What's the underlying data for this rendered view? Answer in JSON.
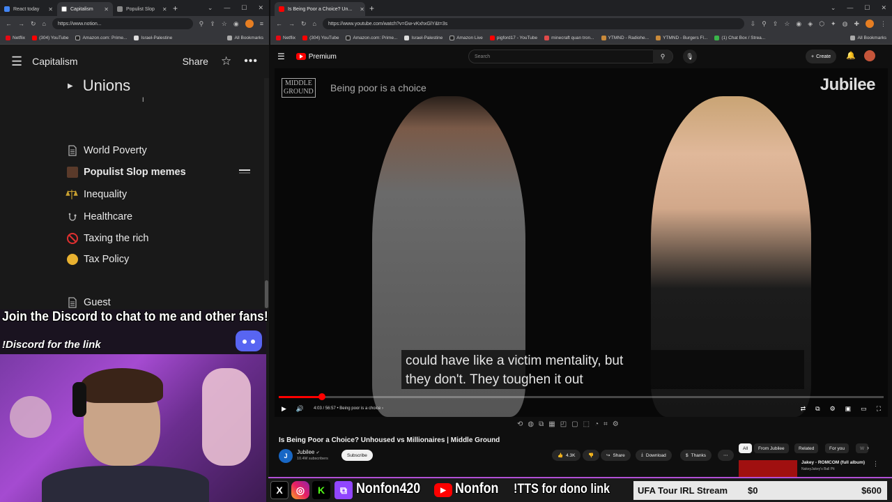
{
  "left_browser": {
    "tabs": [
      {
        "title": "React today",
        "active": false,
        "color": "#4285f4"
      },
      {
        "title": "Capitalism",
        "active": true,
        "color": "#ffffff"
      },
      {
        "title": "Populist Slop",
        "active": false,
        "color": "#8a8a8a"
      }
    ],
    "url": "https://www.notion...",
    "bookmarks": [
      "Netflix",
      "(304) YouTube",
      "Amazon.com: Prime...",
      "Israel-Palestine"
    ],
    "all_bookmarks": "All Bookmarks"
  },
  "notion": {
    "page_title": "Capitalism",
    "share_label": "Share",
    "heading": "Unions",
    "items": [
      {
        "label": "World Poverty",
        "icon": "document-icon"
      },
      {
        "label": "Populist Slop memes",
        "icon": "image-icon"
      },
      {
        "label": "Inequality",
        "icon": "scales-icon"
      },
      {
        "label": "Healthcare",
        "icon": "stethoscope-icon"
      },
      {
        "label": "Taxing the rich",
        "icon": "no-entry-icon"
      },
      {
        "label": "Tax Policy",
        "icon": "coin-icon"
      },
      {
        "label": "Guest",
        "icon": "document-icon"
      }
    ]
  },
  "stream_overlay": {
    "discord_line": "Join the Discord to chat to me and other fans!",
    "discord_sub": "!Discord for the link",
    "handle_1": "Nonfon420",
    "handle_2": "Nonfon",
    "tts": "!TTS for dono link",
    "goal_title": "UFA Tour IRL Stream",
    "goal_current": "$0",
    "goal_target": "$600"
  },
  "right_browser": {
    "tabs": [
      {
        "title": "Is Being Poor a Choice? Un...",
        "active": true,
        "color": "#ff0000"
      }
    ],
    "url": "https://www.youtube.com/watch?v=Gw-vKxhxGlY&t=3s",
    "bookmarks": [
      "Netflix",
      "(304) YouTube",
      "Amazon.com: Prime...",
      "Israel-Palestine",
      "Amazon Live",
      "pigford17 - YouTube",
      "minecraft quan tron...",
      "YTMND - Radiohe...",
      "YTMND - Burgers Fl...",
      "(1) Chat Box / Strea..."
    ],
    "all_bookmarks": "All Bookmarks"
  },
  "youtube": {
    "logo": "Premium",
    "search_placeholder": "Search",
    "create_label": "Create",
    "video": {
      "overlay_logo_line1": "MIDDLE",
      "overlay_logo_line2": "GROUND",
      "overlay_title": "Being poor is a choice",
      "brand": "Jubilee",
      "caption_line1": "could have like a victim mentality, but",
      "caption_line2": "they don't. They toughen it out",
      "time": "4:03 / 56:57",
      "chapter": "Being poor is a choice",
      "progress_fraction": 0.071
    },
    "title": "Is Being Poor a Choice? Unhoused vs Millionaires | Middle Ground",
    "channel": "Jubilee",
    "channel_initial": "J",
    "subscribers": "10.4M subscribers",
    "subscribe_label": "Subscribe",
    "likes": "4.3K",
    "share_label": "Share",
    "download_label": "Download",
    "thanks_label": "Thanks",
    "chips": [
      "All",
      "From Jubilee",
      "Related",
      "For you",
      "W"
    ],
    "side_video_title": "Jakey - ROMCOM (full album)",
    "side_video_channel": "NakeyJakey's Ball Pit"
  }
}
